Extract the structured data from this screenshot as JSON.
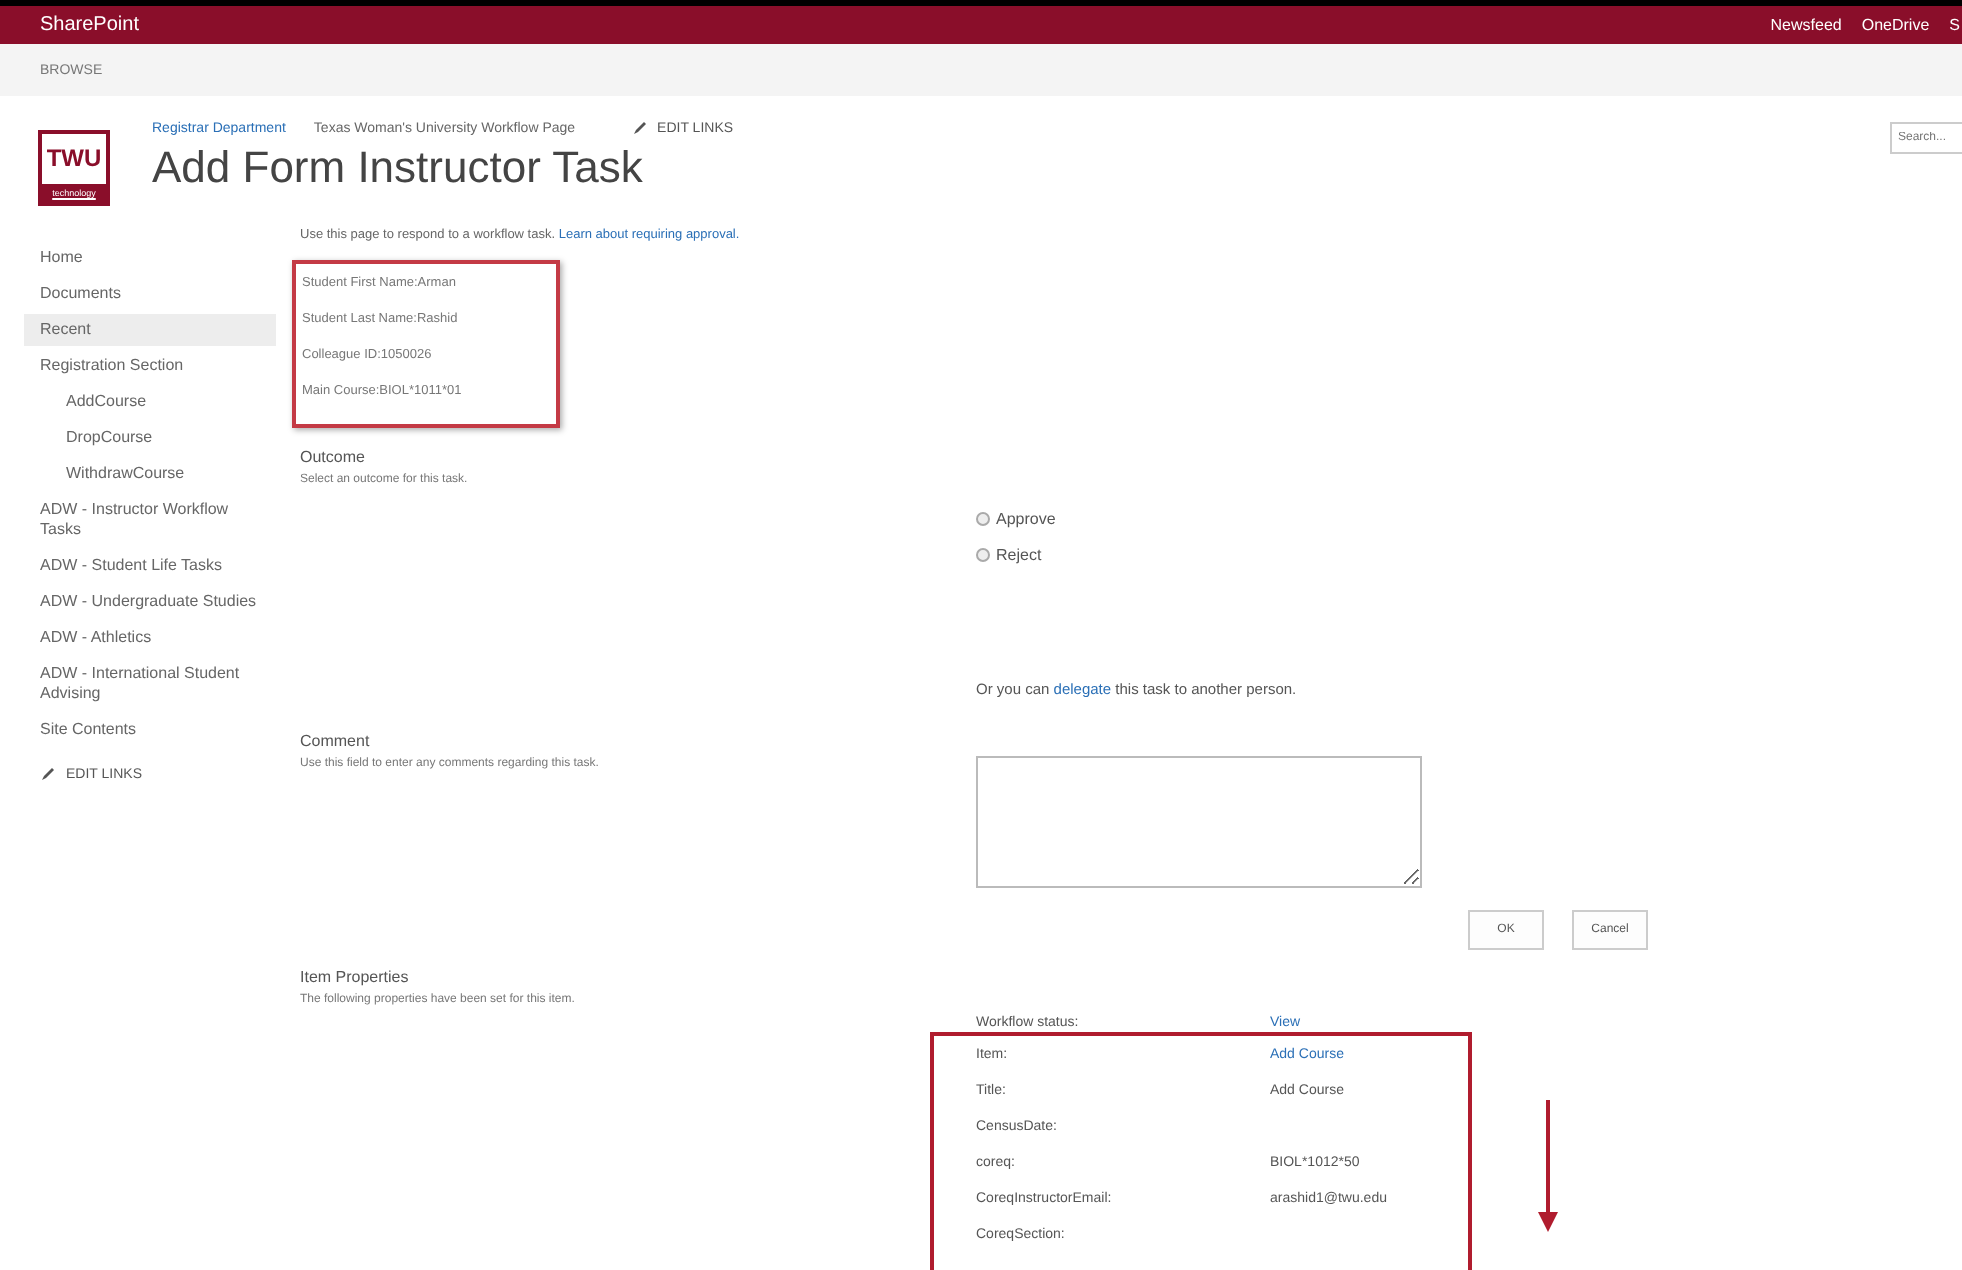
{
  "top_bar": {
    "brand": "SharePoint",
    "links": [
      "Newsfeed",
      "OneDrive",
      "S"
    ]
  },
  "ribbon": {
    "tab": "BROWSE"
  },
  "header": {
    "logo": {
      "top": "TWU",
      "bottom": "technology"
    },
    "breadcrumbs": [
      {
        "label": "Registrar Department",
        "link": true
      },
      {
        "label": "Texas Woman's University Workflow Page",
        "link": false
      }
    ],
    "edit_links": "EDIT LINKS",
    "title": "Add Form Instructor Task",
    "search": {
      "placeholder": "Search..."
    }
  },
  "sidebar": {
    "items": [
      {
        "label": "Home",
        "selected": false
      },
      {
        "label": "Documents",
        "selected": false
      },
      {
        "label": "Recent",
        "selected": true
      },
      {
        "label": "Registration Section",
        "selected": false,
        "children": [
          {
            "label": "AddCourse",
            "selected": false
          },
          {
            "label": "DropCourse",
            "selected": false
          },
          {
            "label": "WithdrawCourse",
            "selected": false
          }
        ]
      },
      {
        "label": "ADW - Instructor Workflow Tasks",
        "selected": false
      },
      {
        "label": "ADW - Student Life Tasks",
        "selected": false
      },
      {
        "label": "ADW - Undergraduate Studies",
        "selected": false
      },
      {
        "label": "ADW - Athletics",
        "selected": false
      },
      {
        "label": "ADW - International Student Advising",
        "selected": false
      },
      {
        "label": "Site Contents",
        "selected": false
      }
    ],
    "edit_links": "EDIT LINKS"
  },
  "intro": {
    "text": "Use this page to respond to a workflow task.",
    "link": "Learn about requiring approval."
  },
  "student_info": [
    "Student First Name:Arman",
    "Student Last Name:Rashid",
    "Colleague ID:1050026",
    "Main Course:BIOL*1011*01"
  ],
  "outcome": {
    "label": "Outcome",
    "hint": "Select an outcome for this task.",
    "options": [
      {
        "label": "Approve",
        "selected": false
      },
      {
        "label": "Reject",
        "selected": false
      }
    ]
  },
  "delegate": {
    "before": "Or you can",
    "link": "delegate",
    "after": "this task to another person."
  },
  "comment": {
    "label": "Comment",
    "hint": "Use this field to enter any comments regarding this task."
  },
  "buttons": [
    "OK",
    "Cancel"
  ],
  "item_properties": {
    "label": "Item Properties",
    "hint": "The following properties have been set for this item.",
    "rows": [
      {
        "name": "Workflow status:",
        "value": "View",
        "link": true
      },
      {
        "name": "Item:",
        "value": "Add Course",
        "link": true
      },
      {
        "name": "Title:",
        "value": "Add Course",
        "link": false
      },
      {
        "name": "CensusDate:"
      },
      {
        "name": "coreq:",
        "value": "BIOL*1012*50",
        "link": false
      },
      {
        "name": "CoreqInstructorEmail:",
        "value": "arashid1@twu.edu",
        "link": false
      },
      {
        "name": "CoreqSection:"
      }
    ]
  }
}
